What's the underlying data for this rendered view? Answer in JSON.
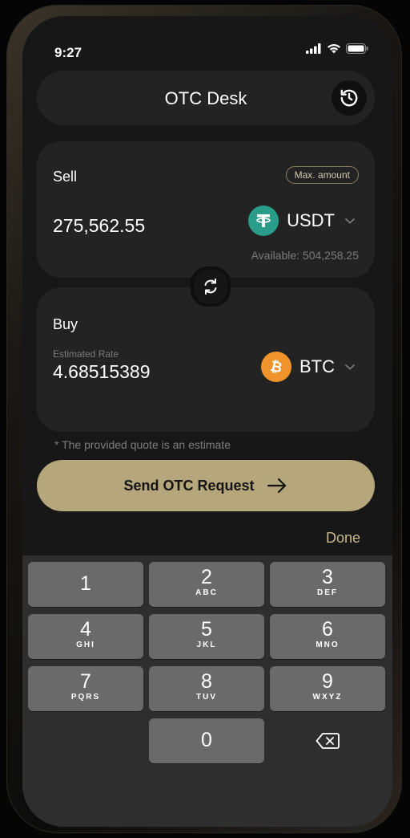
{
  "status": {
    "time": "9:27"
  },
  "header": {
    "title": "OTC Desk",
    "history_icon": "history-icon"
  },
  "sell": {
    "label": "Sell",
    "max_label": "Max. amount",
    "amount": "275,562.55",
    "currency": "USDT",
    "available": "Available: 504,258.25"
  },
  "buy": {
    "label": "Buy",
    "rate_label": "Estimated Rate",
    "amount": "4.68515389",
    "currency": "BTC"
  },
  "note": "* The provided quote is an estimate",
  "send_button": {
    "label": "Send OTC Request"
  },
  "keyboard": {
    "done_label": "Done",
    "keys": [
      {
        "digit": "1",
        "letters": ""
      },
      {
        "digit": "2",
        "letters": "ABC"
      },
      {
        "digit": "3",
        "letters": "DEF"
      },
      {
        "digit": "4",
        "letters": "GHI"
      },
      {
        "digit": "5",
        "letters": "JKL"
      },
      {
        "digit": "6",
        "letters": "MNO"
      },
      {
        "digit": "7",
        "letters": "PQRS"
      },
      {
        "digit": "8",
        "letters": "TUV"
      },
      {
        "digit": "9",
        "letters": "WXYZ"
      },
      {
        "digit": "0",
        "letters": ""
      }
    ]
  },
  "colors": {
    "accent": "#b6a67c",
    "usdt": "#2a9d8a",
    "btc": "#f0932b",
    "card": "#232323",
    "background": "#171717"
  }
}
